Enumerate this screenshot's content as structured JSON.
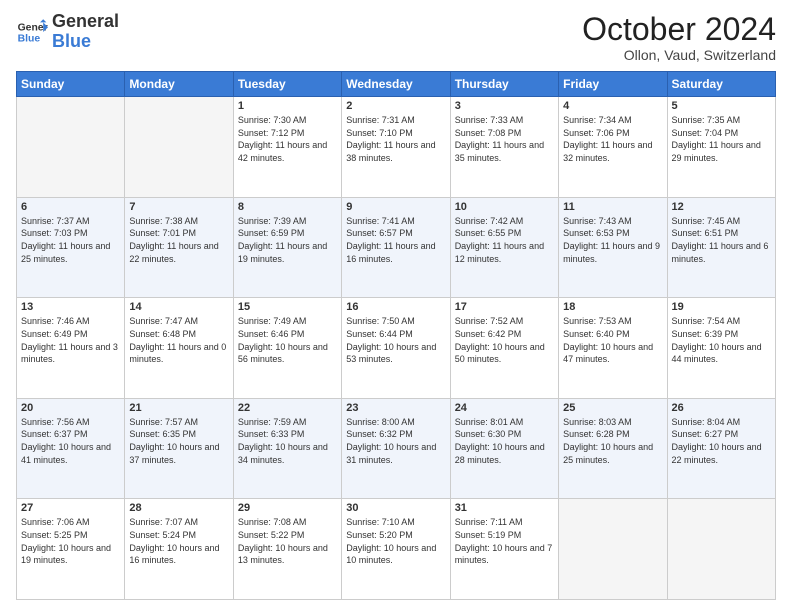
{
  "logo": {
    "general": "General",
    "blue": "Blue"
  },
  "header": {
    "month": "October 2024",
    "location": "Ollon, Vaud, Switzerland"
  },
  "days_of_week": [
    "Sunday",
    "Monday",
    "Tuesday",
    "Wednesday",
    "Thursday",
    "Friday",
    "Saturday"
  ],
  "weeks": [
    [
      {
        "day": "",
        "sunrise": "",
        "sunset": "",
        "daylight": ""
      },
      {
        "day": "",
        "sunrise": "",
        "sunset": "",
        "daylight": ""
      },
      {
        "day": "1",
        "sunrise": "Sunrise: 7:30 AM",
        "sunset": "Sunset: 7:12 PM",
        "daylight": "Daylight: 11 hours and 42 minutes."
      },
      {
        "day": "2",
        "sunrise": "Sunrise: 7:31 AM",
        "sunset": "Sunset: 7:10 PM",
        "daylight": "Daylight: 11 hours and 38 minutes."
      },
      {
        "day": "3",
        "sunrise": "Sunrise: 7:33 AM",
        "sunset": "Sunset: 7:08 PM",
        "daylight": "Daylight: 11 hours and 35 minutes."
      },
      {
        "day": "4",
        "sunrise": "Sunrise: 7:34 AM",
        "sunset": "Sunset: 7:06 PM",
        "daylight": "Daylight: 11 hours and 32 minutes."
      },
      {
        "day": "5",
        "sunrise": "Sunrise: 7:35 AM",
        "sunset": "Sunset: 7:04 PM",
        "daylight": "Daylight: 11 hours and 29 minutes."
      }
    ],
    [
      {
        "day": "6",
        "sunrise": "Sunrise: 7:37 AM",
        "sunset": "Sunset: 7:03 PM",
        "daylight": "Daylight: 11 hours and 25 minutes."
      },
      {
        "day": "7",
        "sunrise": "Sunrise: 7:38 AM",
        "sunset": "Sunset: 7:01 PM",
        "daylight": "Daylight: 11 hours and 22 minutes."
      },
      {
        "day": "8",
        "sunrise": "Sunrise: 7:39 AM",
        "sunset": "Sunset: 6:59 PM",
        "daylight": "Daylight: 11 hours and 19 minutes."
      },
      {
        "day": "9",
        "sunrise": "Sunrise: 7:41 AM",
        "sunset": "Sunset: 6:57 PM",
        "daylight": "Daylight: 11 hours and 16 minutes."
      },
      {
        "day": "10",
        "sunrise": "Sunrise: 7:42 AM",
        "sunset": "Sunset: 6:55 PM",
        "daylight": "Daylight: 11 hours and 12 minutes."
      },
      {
        "day": "11",
        "sunrise": "Sunrise: 7:43 AM",
        "sunset": "Sunset: 6:53 PM",
        "daylight": "Daylight: 11 hours and 9 minutes."
      },
      {
        "day": "12",
        "sunrise": "Sunrise: 7:45 AM",
        "sunset": "Sunset: 6:51 PM",
        "daylight": "Daylight: 11 hours and 6 minutes."
      }
    ],
    [
      {
        "day": "13",
        "sunrise": "Sunrise: 7:46 AM",
        "sunset": "Sunset: 6:49 PM",
        "daylight": "Daylight: 11 hours and 3 minutes."
      },
      {
        "day": "14",
        "sunrise": "Sunrise: 7:47 AM",
        "sunset": "Sunset: 6:48 PM",
        "daylight": "Daylight: 11 hours and 0 minutes."
      },
      {
        "day": "15",
        "sunrise": "Sunrise: 7:49 AM",
        "sunset": "Sunset: 6:46 PM",
        "daylight": "Daylight: 10 hours and 56 minutes."
      },
      {
        "day": "16",
        "sunrise": "Sunrise: 7:50 AM",
        "sunset": "Sunset: 6:44 PM",
        "daylight": "Daylight: 10 hours and 53 minutes."
      },
      {
        "day": "17",
        "sunrise": "Sunrise: 7:52 AM",
        "sunset": "Sunset: 6:42 PM",
        "daylight": "Daylight: 10 hours and 50 minutes."
      },
      {
        "day": "18",
        "sunrise": "Sunrise: 7:53 AM",
        "sunset": "Sunset: 6:40 PM",
        "daylight": "Daylight: 10 hours and 47 minutes."
      },
      {
        "day": "19",
        "sunrise": "Sunrise: 7:54 AM",
        "sunset": "Sunset: 6:39 PM",
        "daylight": "Daylight: 10 hours and 44 minutes."
      }
    ],
    [
      {
        "day": "20",
        "sunrise": "Sunrise: 7:56 AM",
        "sunset": "Sunset: 6:37 PM",
        "daylight": "Daylight: 10 hours and 41 minutes."
      },
      {
        "day": "21",
        "sunrise": "Sunrise: 7:57 AM",
        "sunset": "Sunset: 6:35 PM",
        "daylight": "Daylight: 10 hours and 37 minutes."
      },
      {
        "day": "22",
        "sunrise": "Sunrise: 7:59 AM",
        "sunset": "Sunset: 6:33 PM",
        "daylight": "Daylight: 10 hours and 34 minutes."
      },
      {
        "day": "23",
        "sunrise": "Sunrise: 8:00 AM",
        "sunset": "Sunset: 6:32 PM",
        "daylight": "Daylight: 10 hours and 31 minutes."
      },
      {
        "day": "24",
        "sunrise": "Sunrise: 8:01 AM",
        "sunset": "Sunset: 6:30 PM",
        "daylight": "Daylight: 10 hours and 28 minutes."
      },
      {
        "day": "25",
        "sunrise": "Sunrise: 8:03 AM",
        "sunset": "Sunset: 6:28 PM",
        "daylight": "Daylight: 10 hours and 25 minutes."
      },
      {
        "day": "26",
        "sunrise": "Sunrise: 8:04 AM",
        "sunset": "Sunset: 6:27 PM",
        "daylight": "Daylight: 10 hours and 22 minutes."
      }
    ],
    [
      {
        "day": "27",
        "sunrise": "Sunrise: 7:06 AM",
        "sunset": "Sunset: 5:25 PM",
        "daylight": "Daylight: 10 hours and 19 minutes."
      },
      {
        "day": "28",
        "sunrise": "Sunrise: 7:07 AM",
        "sunset": "Sunset: 5:24 PM",
        "daylight": "Daylight: 10 hours and 16 minutes."
      },
      {
        "day": "29",
        "sunrise": "Sunrise: 7:08 AM",
        "sunset": "Sunset: 5:22 PM",
        "daylight": "Daylight: 10 hours and 13 minutes."
      },
      {
        "day": "30",
        "sunrise": "Sunrise: 7:10 AM",
        "sunset": "Sunset: 5:20 PM",
        "daylight": "Daylight: 10 hours and 10 minutes."
      },
      {
        "day": "31",
        "sunrise": "Sunrise: 7:11 AM",
        "sunset": "Sunset: 5:19 PM",
        "daylight": "Daylight: 10 hours and 7 minutes."
      },
      {
        "day": "",
        "sunrise": "",
        "sunset": "",
        "daylight": ""
      },
      {
        "day": "",
        "sunrise": "",
        "sunset": "",
        "daylight": ""
      }
    ]
  ]
}
